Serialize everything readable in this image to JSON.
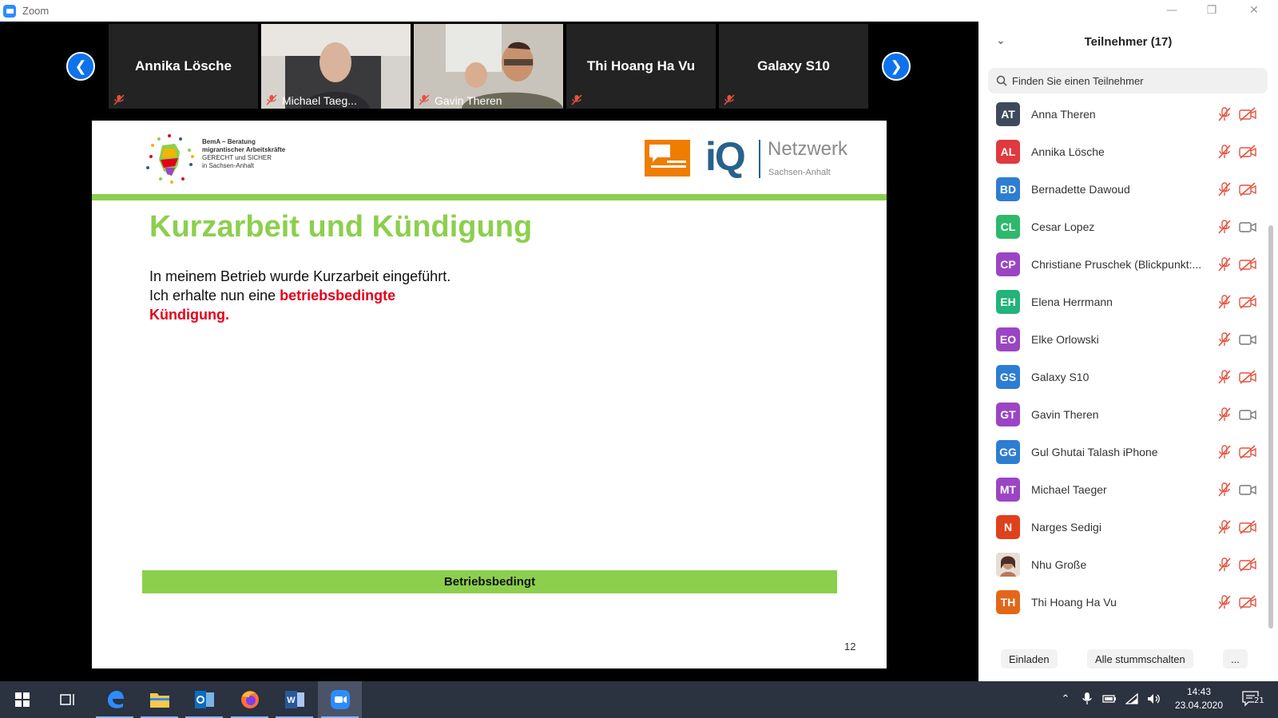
{
  "window": {
    "title": "Zoom"
  },
  "gallery": {
    "tiles": [
      {
        "name": "Annika Lösche",
        "has_video": false
      },
      {
        "name": "Michael Taeg...",
        "has_video": true
      },
      {
        "name": "Gavin Theren",
        "has_video": true
      },
      {
        "name": "Thi Hoang Ha Vu",
        "has_video": false
      },
      {
        "name": "Galaxy S10",
        "has_video": false
      }
    ]
  },
  "slide": {
    "logo_bema_line1": "BemA – Beratung",
    "logo_bema_line2": "migrantischer Arbeitskräfte",
    "logo_bema_line3": "GERECHT und SICHER",
    "logo_bema_line4": "in Sachsen-Anhalt",
    "logo_iq": "iQ",
    "logo_netzwerk": "Netzwerk",
    "logo_region": "Sachsen-Anhalt",
    "heading": "Kurzarbeit und Kündigung",
    "body_line1": "In meinem Betrieb wurde Kurzarbeit eingeführt.",
    "body_line2_prefix": "Ich erhalte nun eine ",
    "body_line2_emphasis": "betriebsbedingte Kündigung",
    "body_line2_suffix": ".",
    "footer_bar": "Betriebsbedingt",
    "page_number": "12"
  },
  "panel": {
    "title": "Teilnehmer (17)",
    "search_placeholder": "Finden Sie einen Teilnehmer",
    "participants": [
      {
        "initials": "AT",
        "name": "Anna Theren",
        "color": "#3e4a5c",
        "muted": true,
        "video_off": true
      },
      {
        "initials": "AL",
        "name": "Annika Lösche",
        "color": "#e0393e",
        "muted": true,
        "video_off": true
      },
      {
        "initials": "BD",
        "name": "Bernadette Dawoud",
        "color": "#2d7dd2",
        "muted": true,
        "video_off": true
      },
      {
        "initials": "CL",
        "name": "Cesar Lopez",
        "color": "#2fb86d",
        "muted": true,
        "video_off": false
      },
      {
        "initials": "CP",
        "name": "Christiane Pruschek (Blickpunkt:...",
        "color": "#9b45c4",
        "muted": true,
        "video_off": true
      },
      {
        "initials": "EH",
        "name": "Elena Herrmann",
        "color": "#22b47a",
        "muted": true,
        "video_off": true
      },
      {
        "initials": "EO",
        "name": "Elke Orlowski",
        "color": "#9b45c4",
        "muted": true,
        "video_off": false
      },
      {
        "initials": "GS",
        "name": "Galaxy S10",
        "color": "#2d7dd2",
        "muted": true,
        "video_off": true
      },
      {
        "initials": "GT",
        "name": "Gavin Theren",
        "color": "#9b45c4",
        "muted": true,
        "video_off": false
      },
      {
        "initials": "GG",
        "name": "Gul Ghutai Talash iPhone",
        "color": "#2d7dd2",
        "muted": true,
        "video_off": true
      },
      {
        "initials": "MT",
        "name": "Michael Taeger",
        "color": "#9b45c4",
        "muted": true,
        "video_off": false
      },
      {
        "initials": "N",
        "name": "Narges Sedigi",
        "color": "#e0401b",
        "muted": true,
        "video_off": true
      },
      {
        "initials": "",
        "name": "Nhu Große",
        "color": "#c9a38a",
        "muted": true,
        "video_off": true
      },
      {
        "initials": "TH",
        "name": "Thi Hoang Ha Vu",
        "color": "#e3671b",
        "muted": true,
        "video_off": true
      }
    ],
    "invite_label": "Einladen",
    "mute_all_label": "Alle stummschalten",
    "more_label": "..."
  },
  "taskbar": {
    "time": "14:43",
    "date": "23.04.2020",
    "notification_count": "21"
  }
}
